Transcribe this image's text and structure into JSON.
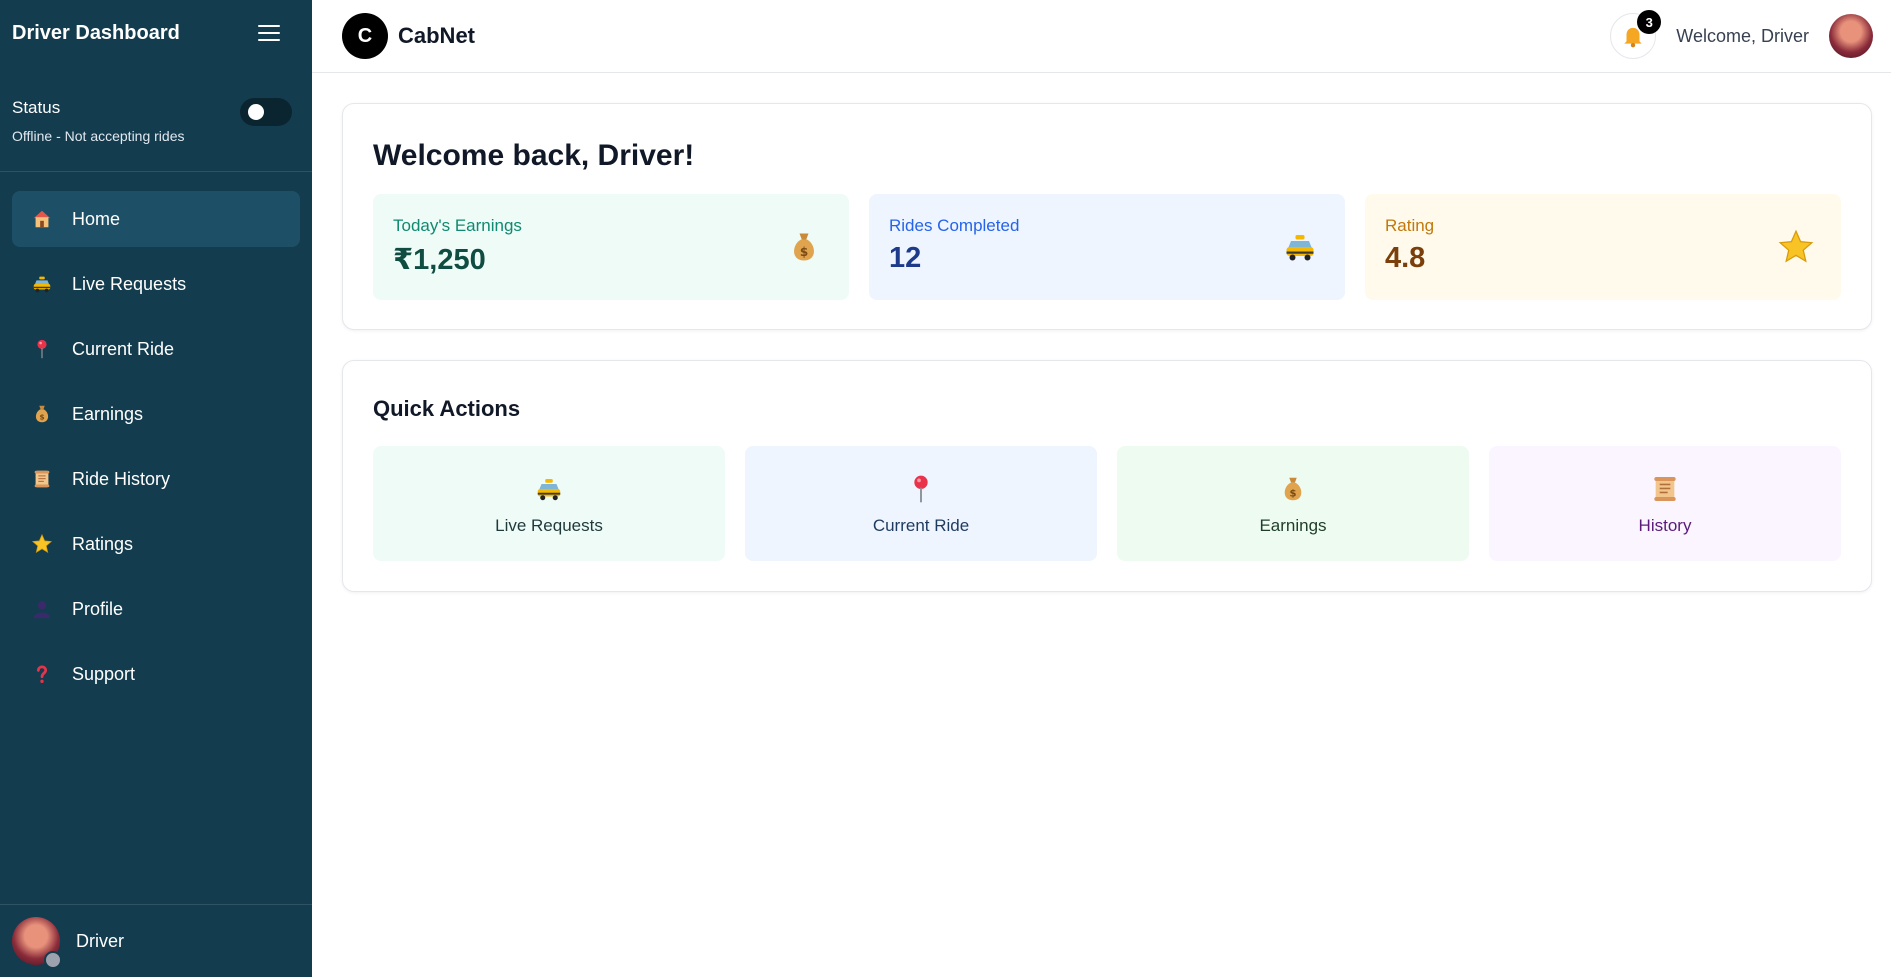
{
  "sidebar": {
    "title": "Driver Dashboard",
    "status_label": "Status",
    "status_text": "Offline - Not accepting rides",
    "status_on": false,
    "items": [
      {
        "label": "Home",
        "icon": "house-icon",
        "active": true
      },
      {
        "label": "Live Requests",
        "icon": "taxi-icon",
        "active": false
      },
      {
        "label": "Current Ride",
        "icon": "map-pin-icon",
        "active": false
      },
      {
        "label": "Earnings",
        "icon": "money-bag-icon",
        "active": false
      },
      {
        "label": "Ride History",
        "icon": "scroll-icon",
        "active": false
      },
      {
        "label": "Ratings",
        "icon": "star-icon",
        "active": false
      },
      {
        "label": "Profile",
        "icon": "user-icon",
        "active": false
      },
      {
        "label": "Support",
        "icon": "question-icon",
        "active": false
      }
    ],
    "footer_name": "Driver"
  },
  "header": {
    "logo_letter": "C",
    "brand": "CabNet",
    "notification_count": "3",
    "welcome": "Welcome, Driver"
  },
  "main": {
    "welcome_title": "Welcome back, Driver!",
    "stats": [
      {
        "label": "Today's Earnings",
        "value": "₹1,250",
        "icon": "money-bag-icon"
      },
      {
        "label": "Rides Completed",
        "value": "12",
        "icon": "taxi-icon"
      },
      {
        "label": "Rating",
        "value": "4.8",
        "icon": "star-icon"
      }
    ],
    "quick_actions_title": "Quick Actions",
    "actions": [
      {
        "label": "Live Requests",
        "icon": "taxi-icon"
      },
      {
        "label": "Current Ride",
        "icon": "map-pin-icon"
      },
      {
        "label": "Earnings",
        "icon": "money-bag-icon"
      },
      {
        "label": "History",
        "icon": "scroll-icon"
      }
    ]
  },
  "colors": {
    "sidebar_bg": "#133c4e",
    "sidebar_active": "#1d5066",
    "earnings_accent": "#0f8a70",
    "rides_accent": "#2563eb",
    "rating_accent": "#c2780b"
  }
}
